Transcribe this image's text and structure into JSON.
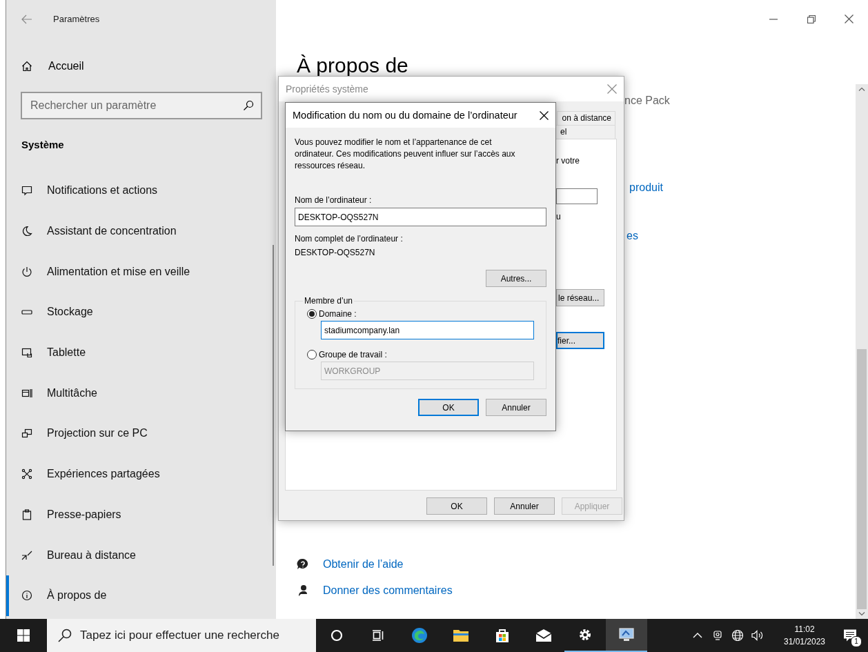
{
  "settings": {
    "title": "Paramètres",
    "home": "Accueil",
    "search_placeholder": "Rechercher un paramètre",
    "section": "Système",
    "nav_items": [
      {
        "label": "Notifications et actions",
        "selected": false
      },
      {
        "label": "Assistant de concentration",
        "selected": false
      },
      {
        "label": "Alimentation et mise en veille",
        "selected": false
      },
      {
        "label": "Stockage",
        "selected": false
      },
      {
        "label": "Tablette",
        "selected": false
      },
      {
        "label": "Multitâche",
        "selected": false
      },
      {
        "label": "Projection sur ce PC",
        "selected": false
      },
      {
        "label": "Expériences partagées",
        "selected": false
      },
      {
        "label": "Presse-papiers",
        "selected": false
      },
      {
        "label": "Bureau à distance",
        "selected": false
      },
      {
        "label": "À propos de",
        "selected": true
      }
    ],
    "page_title": "À propos de",
    "behind_texts": [
      {
        "kind": "text",
        "text": "nce Pack"
      },
      {
        "kind": "link",
        "text": "produit"
      },
      {
        "kind": "link",
        "text": "es"
      }
    ],
    "links": [
      {
        "label": "Obtenir de l’aide"
      },
      {
        "label": "Donner des commentaires"
      }
    ]
  },
  "system_properties": {
    "title": "Propriétés système",
    "tabs": [
      {
        "label": "on à distance",
        "selected": false
      },
      {
        "label": "el",
        "selected": false
      }
    ],
    "panel_items": [
      {
        "kind": "text",
        "text": "r votre"
      },
      {
        "kind": "field"
      },
      {
        "kind": "text",
        "text": "u"
      },
      {
        "kind": "button",
        "label": "le réseau...",
        "default": false
      },
      {
        "kind": "button",
        "label": "fier...",
        "default": true
      }
    ],
    "buttons": [
      {
        "label": "OK",
        "disabled": false
      },
      {
        "label": "Annuler",
        "disabled": false
      },
      {
        "label": "Appliquer",
        "disabled": true
      }
    ]
  },
  "name_dialog": {
    "title": "Modification du nom ou du domaine de l’ordinateur",
    "description": "Vous pouvez modifier le nom et l’appartenance de cet ordinateur. Ces modifications peuvent influer sur l’accès aux ressources réseau.",
    "computer_name_label": "Nom de l’ordinateur :",
    "computer_name": "DESKTOP-OQS527N",
    "full_name_label": "Nom complet de l’ordinateur :",
    "full_name": "DESKTOP-OQS527N",
    "more_button": "Autres...",
    "member_legend": "Membre d’un",
    "member_options": [
      {
        "label": "Domaine :",
        "selected": true,
        "value": "stadiumcompany.lan",
        "disabled": false
      },
      {
        "label": "Groupe de travail :",
        "selected": false,
        "value": "WORKGROUP",
        "disabled": true
      }
    ],
    "buttons": [
      {
        "label": "OK",
        "default": true
      },
      {
        "label": "Annuler",
        "default": false
      }
    ]
  },
  "taskbar": {
    "search_placeholder": "Tapez ici pour effectuer une recherche",
    "apps": [
      {
        "active": false,
        "foreground": false
      },
      {
        "active": false,
        "foreground": false
      },
      {
        "active": false,
        "foreground": false
      },
      {
        "active": false,
        "foreground": false
      },
      {
        "active": true,
        "foreground": false
      },
      {
        "active": true,
        "foreground": true
      }
    ],
    "time": "11:02",
    "date": "31/01/2023",
    "notification_count": "1"
  }
}
